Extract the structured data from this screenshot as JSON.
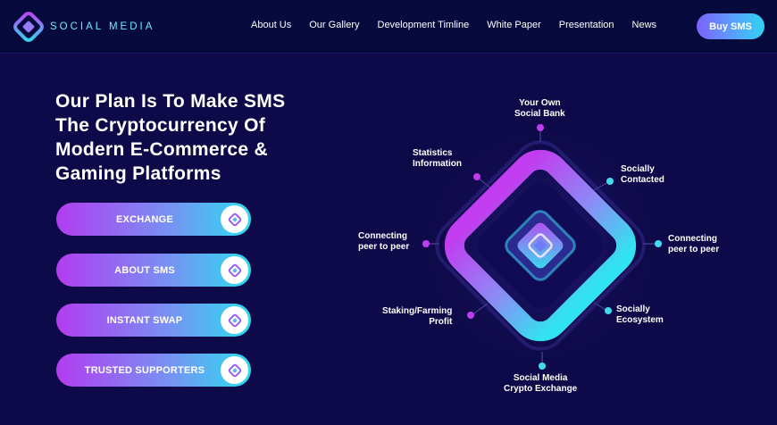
{
  "brand": {
    "name": "SOCIAL MEDIA",
    "logo_icon": "diamond-logo-icon"
  },
  "nav": {
    "links": [
      "About Us",
      "Our Gallery",
      "Development Timline",
      "White Paper",
      "Presentation",
      "News"
    ],
    "buy_label": "Buy SMS"
  },
  "hero": {
    "title_lines": [
      "Our Plan Is To Make SMS",
      "The Cryptocurrency Of",
      "Modern E-Commerce &",
      "Gaming Platforms"
    ]
  },
  "actions": [
    {
      "label": "EXCHANGE",
      "icon": "diamond-icon"
    },
    {
      "label": "ABOUT SMS",
      "icon": "diamond-icon"
    },
    {
      "label": "INSTANT SWAP",
      "icon": "diamond-icon"
    },
    {
      "label": "TRUSTED SUPPORTERS",
      "icon": "diamond-icon"
    }
  ],
  "diagram": {
    "labels": {
      "top": [
        "Your Own",
        "Social Bank"
      ],
      "top_left": [
        "Statistics",
        "Information"
      ],
      "top_right": [
        "Socially",
        "Contacted"
      ],
      "left": [
        "Connecting",
        "peer to peer"
      ],
      "right": [
        "Connecting",
        "peer to peer"
      ],
      "bottom_left": [
        "Staking/Farming",
        "Profit"
      ],
      "bottom_right": [
        "Socially",
        "Ecosystem"
      ],
      "bottom": [
        "Social Media",
        "Crypto Exchange"
      ]
    }
  },
  "colors": {
    "background": "#0e0948",
    "navbar": "#070a3c",
    "accent_purple": "#b23cf0",
    "accent_cyan": "#2fdcef",
    "brand_text": "#6fe8ff"
  }
}
